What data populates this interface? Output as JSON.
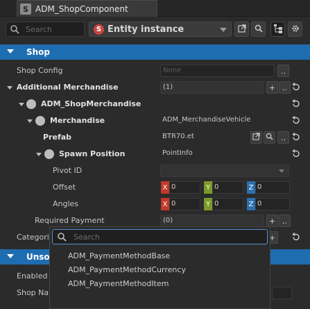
{
  "window": {
    "component_title": "ADM_ShopComponent",
    "component_icon": "S"
  },
  "toolbar": {
    "search_placeholder": "Search",
    "entity_dropdown_label": "Entity instance",
    "entity_icon": "S"
  },
  "sections": {
    "shop": "Shop",
    "unsorted": "Unso"
  },
  "rows": {
    "shop_config": {
      "label": "Shop Config",
      "placeholder": "None",
      "button": ".."
    },
    "additional_merchandise": {
      "label": "Additional Merchandise",
      "value": "(1)",
      "add": "+",
      "more": ".."
    },
    "adm_shop_merchandise": {
      "label": "ADM_ShopMerchandise"
    },
    "merchandise": {
      "label": "Merchandise",
      "value": "ADM_MerchandiseVehicle"
    },
    "prefab": {
      "label": "Prefab",
      "value": "BTR70.et",
      "button": ".."
    },
    "spawn_position": {
      "label": "Spawn Position",
      "value": "PointInfo"
    },
    "pivot_id": {
      "label": "Pivot ID"
    },
    "offset": {
      "label": "Offset",
      "x": "0",
      "y": "0",
      "z": "0"
    },
    "angles": {
      "label": "Angles",
      "x": "0",
      "y": "0",
      "z": "0"
    },
    "required_payment": {
      "label": "Required Payment",
      "value": "(0)",
      "add": "+",
      "more": ".."
    },
    "categories": {
      "label": "Categori"
    },
    "enabled": {
      "label": "Enabled"
    },
    "shop_name": {
      "label": "Shop Na"
    }
  },
  "axis_labels": {
    "x": "X",
    "y": "Y",
    "z": "Z"
  },
  "popup": {
    "search_placeholder": "Search",
    "items": [
      "ADM_PaymentMethodBase",
      "ADM_PaymentMethodCurrency",
      "ADM_PaymentMethodItem"
    ]
  }
}
